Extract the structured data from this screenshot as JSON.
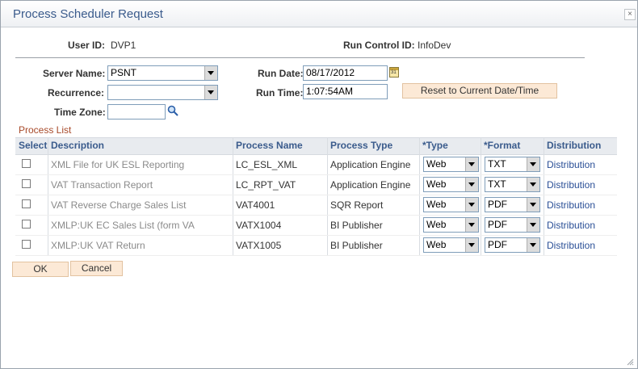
{
  "window": {
    "title": "Process Scheduler Request",
    "close_label": "×"
  },
  "header": {
    "user_id_label": "User ID:",
    "user_id": "DVP1",
    "run_control_label": "Run Control ID:",
    "run_control_id": "InfoDev"
  },
  "form": {
    "server_name_label": "Server Name:",
    "server_name": "PSNT",
    "recurrence_label": "Recurrence:",
    "recurrence": "",
    "time_zone_label": "Time Zone:",
    "time_zone": "",
    "run_date_label": "Run Date:",
    "run_date": "08/17/2012",
    "run_time_label": "Run Time:",
    "run_time": "1:07:54AM",
    "reset_button": "Reset to Current Date/Time"
  },
  "process_list": {
    "title": "Process List",
    "columns": [
      "Select",
      "Description",
      "Process Name",
      "Process Type",
      "*Type",
      "*Format",
      "Distribution"
    ],
    "rows": [
      {
        "description": "XML File for UK ESL Reporting",
        "process_name": "LC_ESL_XML",
        "process_type": "Application Engine",
        "type": "Web",
        "format": "TXT",
        "distribution": "Distribution",
        "selected": false
      },
      {
        "description": "VAT Transaction Report",
        "process_name": "LC_RPT_VAT",
        "process_type": "Application Engine",
        "type": "Web",
        "format": "TXT",
        "distribution": "Distribution",
        "selected": false
      },
      {
        "description": "VAT Reverse Charge Sales List",
        "process_name": "VAT4001",
        "process_type": "SQR Report",
        "type": "Web",
        "format": "PDF",
        "distribution": "Distribution",
        "selected": false
      },
      {
        "description": "XMLP:UK EC Sales List (form VA",
        "process_name": "VATX1004",
        "process_type": "BI Publisher",
        "type": "Web",
        "format": "PDF",
        "distribution": "Distribution",
        "selected": false
      },
      {
        "description": "XMLP:UK VAT Return",
        "process_name": "VATX1005",
        "process_type": "BI Publisher",
        "type": "Web",
        "format": "PDF",
        "distribution": "Distribution",
        "selected": false
      }
    ]
  },
  "buttons": {
    "ok": "OK",
    "cancel": "Cancel"
  },
  "colors": {
    "title": "#3a5b8c",
    "link": "#2a4f96",
    "section": "#a84a2a",
    "button_bg": "#fce9d6"
  }
}
